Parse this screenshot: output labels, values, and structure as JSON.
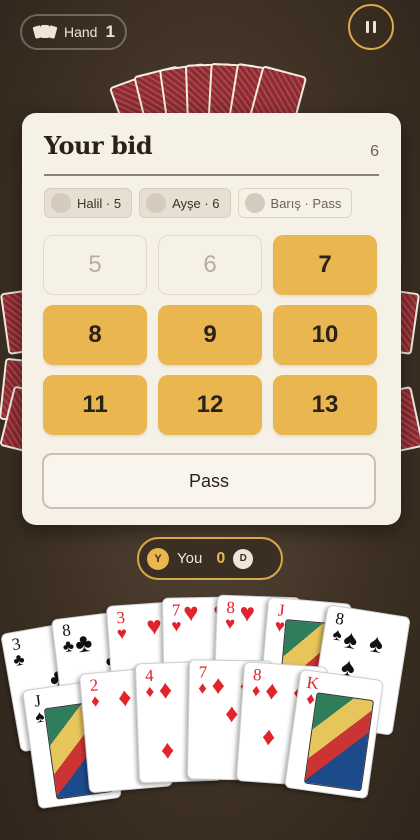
{
  "hud": {
    "hand_label": "Hand",
    "hand_number": "1"
  },
  "bid_panel": {
    "title": "Your bid",
    "count": "6",
    "players": [
      {
        "label": "Halil · 5",
        "state": "bid"
      },
      {
        "label": "Ayşe · 6",
        "state": "bid"
      },
      {
        "label": "Barış · Pass",
        "state": "pass"
      }
    ],
    "bids": [
      {
        "label": "5",
        "enabled": false
      },
      {
        "label": "6",
        "enabled": false
      },
      {
        "label": "7",
        "enabled": true
      },
      {
        "label": "8",
        "enabled": true
      },
      {
        "label": "9",
        "enabled": true
      },
      {
        "label": "10",
        "enabled": true
      },
      {
        "label": "11",
        "enabled": true
      },
      {
        "label": "12",
        "enabled": true
      },
      {
        "label": "13",
        "enabled": true
      }
    ],
    "pass_label": "Pass"
  },
  "player": {
    "badge": "Y",
    "name": "You",
    "score": "0",
    "dealer_badge": "D"
  },
  "hand": {
    "back_row": [
      {
        "rank": "3",
        "suit": "♣",
        "color": "black"
      },
      {
        "rank": "8",
        "suit": "♣",
        "color": "black"
      },
      {
        "rank": "3",
        "suit": "♥",
        "color": "red"
      },
      {
        "rank": "7",
        "suit": "♥",
        "color": "red"
      },
      {
        "rank": "8",
        "suit": "♥",
        "color": "red"
      },
      {
        "rank": "J",
        "suit": "♥",
        "color": "red"
      },
      {
        "rank": "8",
        "suit": "♠",
        "color": "black"
      }
    ],
    "front_row": [
      {
        "rank": "J",
        "suit": "♠",
        "color": "black"
      },
      {
        "rank": "2",
        "suit": "♦",
        "color": "red"
      },
      {
        "rank": "4",
        "suit": "♦",
        "color": "red"
      },
      {
        "rank": "7",
        "suit": "♦",
        "color": "red"
      },
      {
        "rank": "8",
        "suit": "♦",
        "color": "red"
      },
      {
        "rank": "K",
        "suit": "♦",
        "color": "red"
      }
    ]
  }
}
